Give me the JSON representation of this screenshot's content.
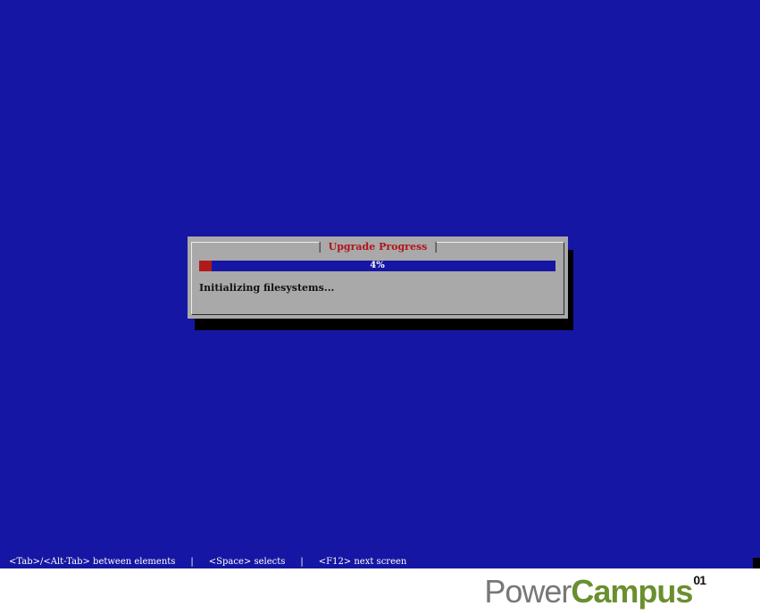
{
  "dialog": {
    "title": "Upgrade Progress",
    "progress": {
      "percent": 4,
      "label": "4%"
    },
    "status": "Initializing filesystems..."
  },
  "help_bar": {
    "items": [
      "<Tab>/<Alt-Tab> between elements",
      "<Space> selects",
      "<F12> next screen"
    ],
    "separator": "|"
  },
  "watermark": {
    "part1": "Power",
    "part2": "Campus",
    "superscript": "01"
  },
  "colors": {
    "screen_background": "#1616a4",
    "dialog_background": "#a9a9a9",
    "title_text": "#b0141a",
    "progress_fill": "#b01a1a",
    "progress_track": "#1616a4",
    "watermark_gray": "#777777",
    "watermark_green": "#6a8f2f"
  }
}
